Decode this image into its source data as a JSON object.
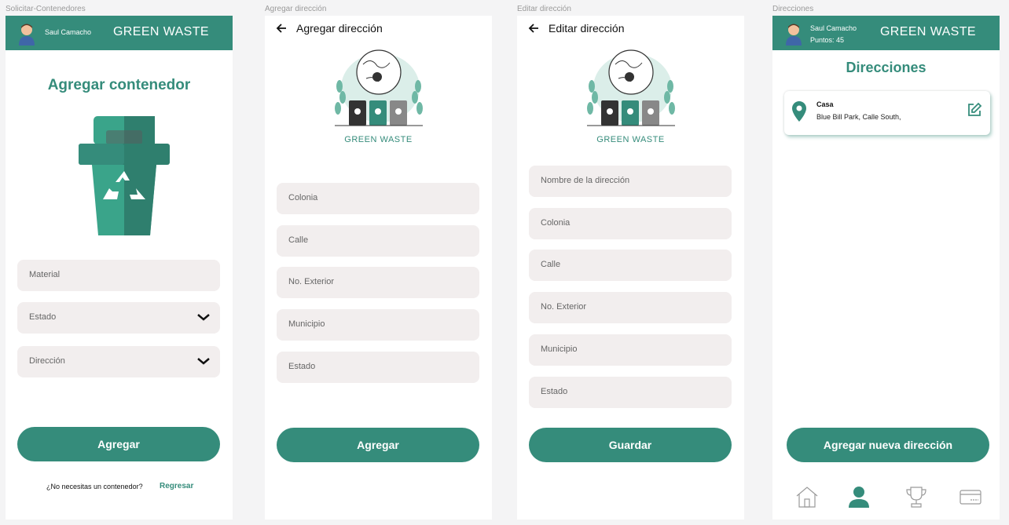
{
  "frames": {
    "f1": {
      "label": "Solicitar-Contenedores",
      "user": "Saul Camacho",
      "brand": "GREEN WASTE",
      "title": "Agregar contenedor",
      "material_placeholder": "Material",
      "estado_placeholder": "Estado",
      "direccion_placeholder": "Dirección",
      "button": "Agregar",
      "footer_question": "¿No necesitas un contenedor?",
      "footer_link": "Regresar"
    },
    "f2": {
      "label": "Agregar dirección",
      "title": "Agregar dirección",
      "logo_text": "GREEN WASTE",
      "fields": [
        "Colonia",
        "Calle",
        "No. Exterior",
        "Municipio",
        "Estado"
      ],
      "button": "Agregar"
    },
    "f3": {
      "label": "Editar dirección",
      "title": "Editar dirección",
      "logo_text": "GREEN WASTE",
      "fields": [
        "Nombre de la dirección",
        "Colonia",
        "Calle",
        "No. Exterior",
        "Municipio",
        "Estado"
      ],
      "button": "Guardar"
    },
    "f4": {
      "label": "Direcciones",
      "user": "Saul Camacho",
      "points": "Puntos: 45",
      "brand": "GREEN WASTE",
      "title": "Direcciones",
      "address_name": "Casa",
      "address_detail": "Blue Bill Park, Calle South,",
      "button": "Agregar nueva dirección"
    }
  },
  "colors": {
    "primary": "#358c7b",
    "field_bg": "#f2eeee",
    "bin_light": "#3aa48a",
    "bin_dark": "#2f7f6e"
  },
  "icons": [
    "avatar",
    "back-arrow-icon",
    "chevron-down-icon",
    "recycle-bin-icon",
    "location-pin-icon",
    "edit-icon",
    "home-icon",
    "user-icon",
    "trophy-icon",
    "card-icon"
  ]
}
